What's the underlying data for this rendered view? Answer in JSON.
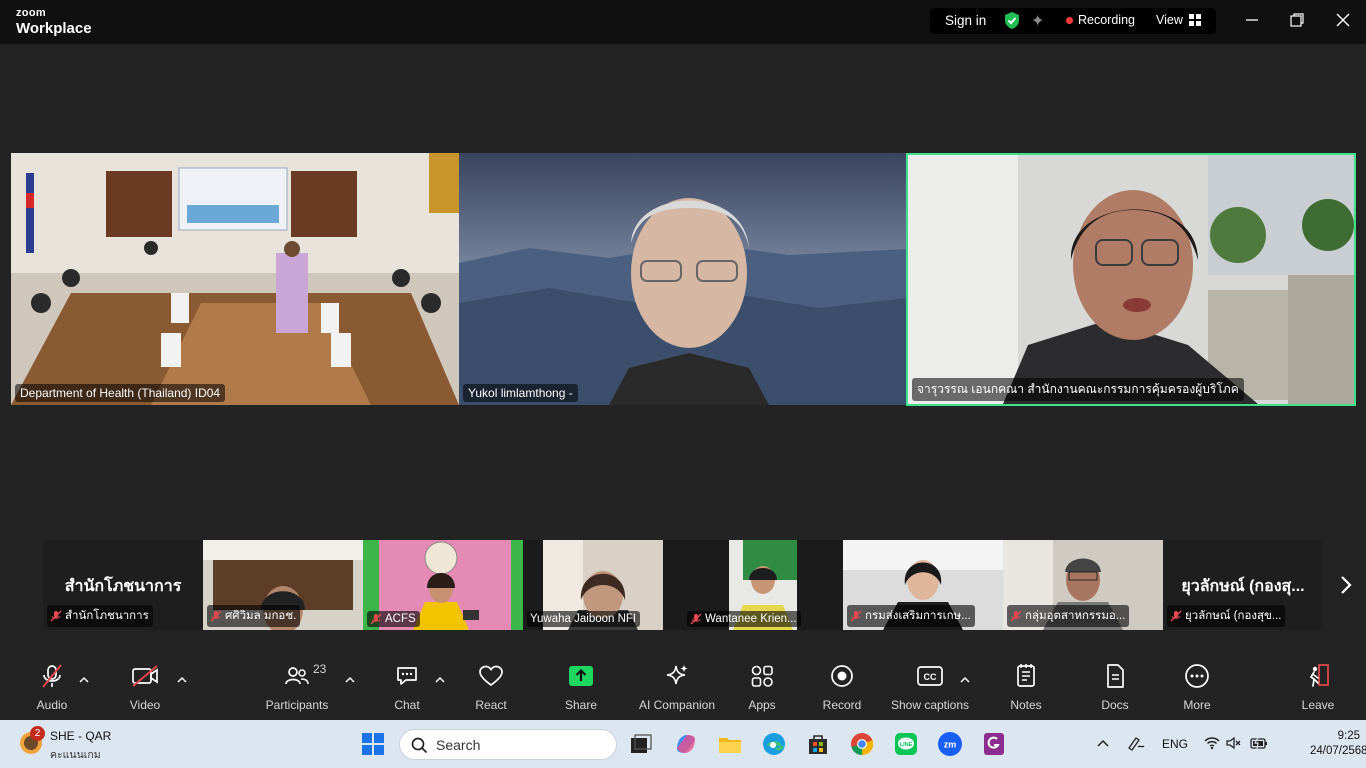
{
  "titlebar": {
    "brand_top": "zoom",
    "brand_bottom": "Workplace",
    "sign_in": "Sign in",
    "recording": "Recording",
    "view": "View"
  },
  "tiles": [
    {
      "name": "Department of Health (Thailand) ID04",
      "active": false
    },
    {
      "name": "Yukol limlamthong -",
      "active": false
    },
    {
      "name": "จารุวรรณ เอนกคณา สำนักงานคณะกรรมการคุ้มครองผู้บริโภค",
      "active": true
    }
  ],
  "gallery": [
    {
      "big": "สำนักโภชนาการ",
      "name": "สำนักโภชนาการ",
      "muted": true
    },
    {
      "big": "",
      "name": "ศศิวิมล มกอช.",
      "muted": true
    },
    {
      "big": "",
      "name": "ACFS",
      "muted": true
    },
    {
      "big": "",
      "name": "Yuwaha Jaiboon NFI",
      "muted": false
    },
    {
      "big": "",
      "name": "Wantanee Krien...",
      "muted": true
    },
    {
      "big": "",
      "name": "กรมส่งเสริมการเกษ...",
      "muted": true
    },
    {
      "big": "",
      "name": "กลุ่มอุตสาหกรรมอ...",
      "muted": true
    },
    {
      "big": "ยุวลักษณ์ (กองสุ...",
      "name": "ยุวลักษณ์ (กองสุข...",
      "muted": true
    }
  ],
  "toolbar": {
    "audio": "Audio",
    "video": "Video",
    "participants": "Participants",
    "participants_count": "23",
    "chat": "Chat",
    "react": "React",
    "share": "Share",
    "ai": "AI Companion",
    "apps": "Apps",
    "record": "Record",
    "captions": "Show captions",
    "notes": "Notes",
    "docs": "Docs",
    "more": "More",
    "leave": "Leave"
  },
  "taskbar": {
    "weather_badge": "2",
    "weather_title": "SHE - QAR",
    "weather_sub": "คะแนนเกม",
    "search": "Search",
    "lang": "ENG",
    "time": "9:25",
    "date": "24/07/2568"
  },
  "colors": {
    "accent_green": "#3ee08a",
    "share_green": "#1ed760",
    "mute_red": "#e5484d",
    "record_red": "#ff3b3b"
  }
}
